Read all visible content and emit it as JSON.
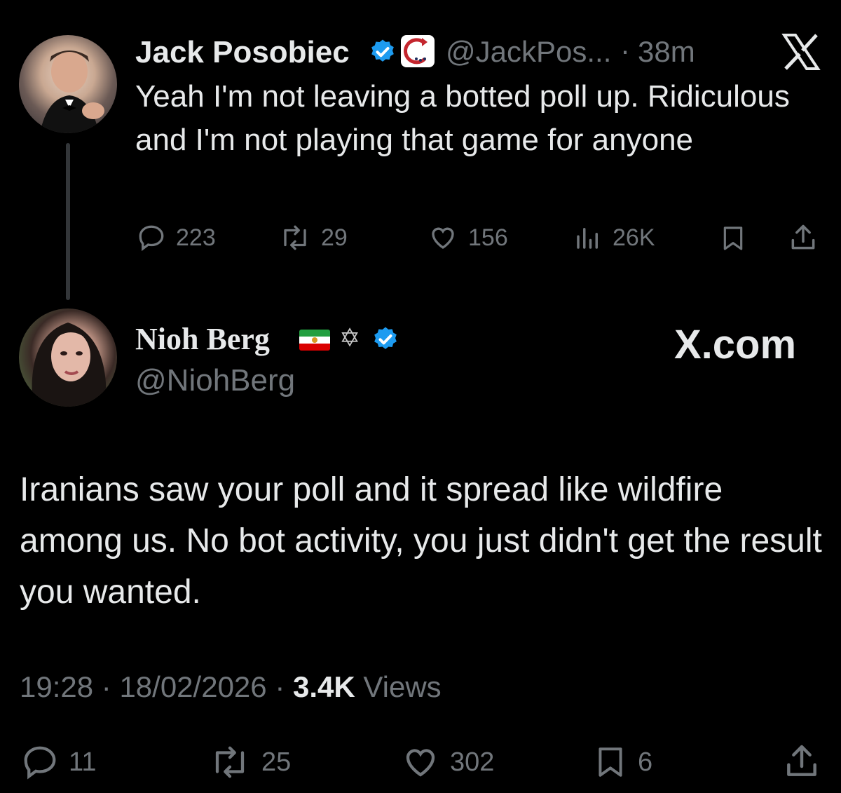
{
  "tweet1": {
    "author_name": "Jack Posobiec",
    "author_handle": "@JackPos...",
    "separator": "·",
    "timestamp": "38m",
    "text": "Yeah I'm not leaving a botted poll up. Ridiculous and I'm not playing that game for anyone",
    "stats": {
      "replies": "223",
      "reposts": "29",
      "likes": "156",
      "views": "26K"
    },
    "icons": [
      "verified-badge-icon",
      "affiliate-badge-icon",
      "x-logo-icon",
      "reply-icon",
      "repost-icon",
      "like-icon",
      "views-icon",
      "bookmark-icon",
      "share-icon"
    ]
  },
  "tweet2": {
    "author_name": "Nioh Berg",
    "author_handle": "@NiohBerg",
    "brand": "X.com",
    "text": "Iranians saw your poll and it spread like wildfire among us. No bot activity, you just didn't get the result you wanted.",
    "time": "19:28",
    "sep1": " · ",
    "date": "18/02/2026",
    "sep2": " · ",
    "views_count": "3.4K",
    "views_label": " Views",
    "stats": {
      "replies": "11",
      "reposts": "25",
      "likes": "302",
      "bookmarks": "6"
    },
    "icons": [
      "iran-flag-icon",
      "star-of-david-icon",
      "verified-badge-icon",
      "reply-icon",
      "repost-icon",
      "like-icon",
      "bookmark-icon",
      "share-icon"
    ]
  },
  "colors": {
    "background": "#000000",
    "text": "#e7e9ea",
    "muted": "#71767b",
    "verified": "#1d9bf0"
  }
}
